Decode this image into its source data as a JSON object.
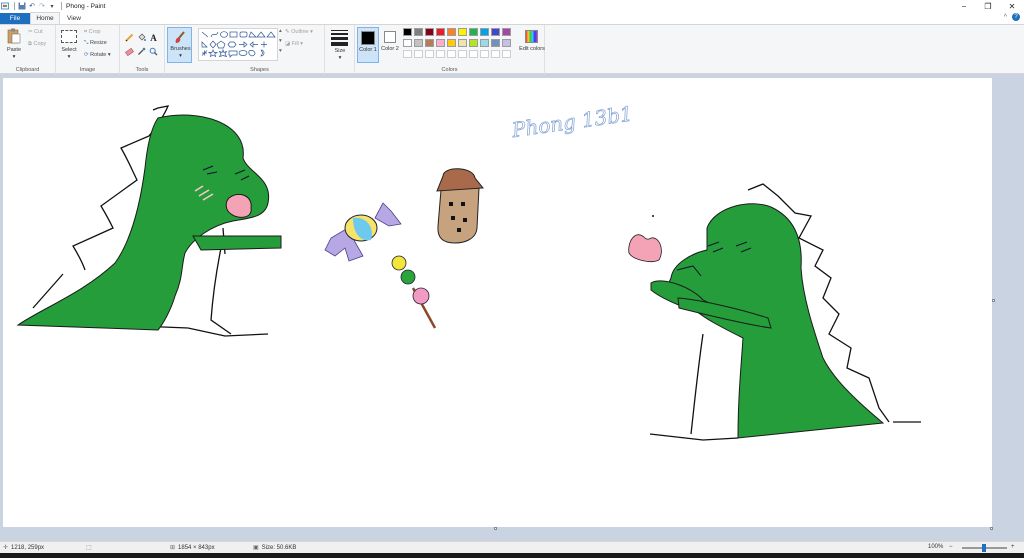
{
  "window": {
    "title": "Phong - Paint",
    "minimize": "−",
    "maximize": "❐",
    "close": "✕"
  },
  "tabs": {
    "file": "File",
    "home": "Home",
    "view": "View",
    "collapse": "^",
    "help": "?"
  },
  "ribbon": {
    "clipboard": {
      "label": "Clipboard",
      "paste": "Paste",
      "cut": "Cut",
      "copy": "Copy"
    },
    "image": {
      "label": "Image",
      "select": "Select",
      "crop": "Crop",
      "resize": "Resize",
      "rotate": "Rotate"
    },
    "tools": {
      "label": "Tools"
    },
    "shapes": {
      "label": "Shapes",
      "outline": "Outline",
      "fill": "Fill"
    },
    "brushes": {
      "label": "Brushes"
    },
    "size": {
      "label": "Size"
    },
    "colors": {
      "label": "Colors",
      "color1": "Color 1",
      "color2": "Color 2",
      "edit": "Edit colors",
      "color1_value": "#000000",
      "color2_value": "#ffffff",
      "palette_row1": [
        "#000000",
        "#7f7f7f",
        "#880015",
        "#ed1c24",
        "#ff7f27",
        "#fff200",
        "#22b14c",
        "#00a2e8",
        "#3f48cc",
        "#a349a4"
      ],
      "palette_row2": [
        "#ffffff",
        "#c3c3c3",
        "#b97a57",
        "#ffaec9",
        "#ffc90e",
        "#efe4b0",
        "#b5e61d",
        "#99d9ea",
        "#7092be",
        "#c8bfe7"
      ]
    }
  },
  "canvas": {
    "handwriting": "Phong 13b1"
  },
  "status": {
    "cursor": "1218, 259px",
    "dimensions": "1854 × 843px",
    "size": "Size: 50.6KB",
    "zoom": "100%",
    "zoom_out": "−",
    "zoom_in": "+"
  }
}
